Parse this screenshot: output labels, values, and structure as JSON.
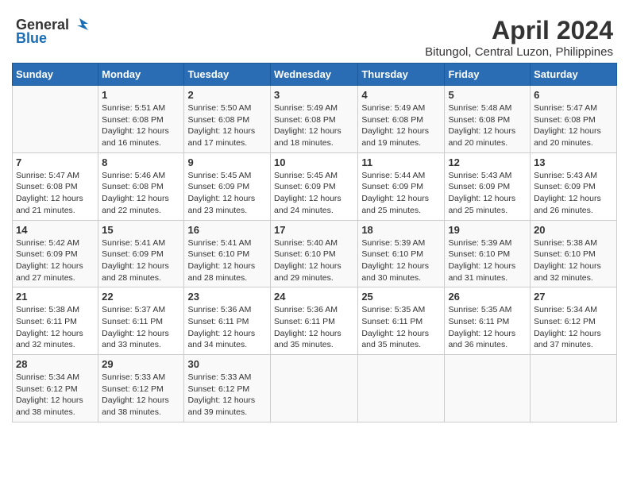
{
  "header": {
    "logo_general": "General",
    "logo_blue": "Blue",
    "title": "April 2024",
    "subtitle": "Bitungol, Central Luzon, Philippines"
  },
  "days_of_week": [
    "Sunday",
    "Monday",
    "Tuesday",
    "Wednesday",
    "Thursday",
    "Friday",
    "Saturday"
  ],
  "weeks": [
    {
      "days": [
        {
          "number": "",
          "info": ""
        },
        {
          "number": "1",
          "info": "Sunrise: 5:51 AM\nSunset: 6:08 PM\nDaylight: 12 hours\nand 16 minutes."
        },
        {
          "number": "2",
          "info": "Sunrise: 5:50 AM\nSunset: 6:08 PM\nDaylight: 12 hours\nand 17 minutes."
        },
        {
          "number": "3",
          "info": "Sunrise: 5:49 AM\nSunset: 6:08 PM\nDaylight: 12 hours\nand 18 minutes."
        },
        {
          "number": "4",
          "info": "Sunrise: 5:49 AM\nSunset: 6:08 PM\nDaylight: 12 hours\nand 19 minutes."
        },
        {
          "number": "5",
          "info": "Sunrise: 5:48 AM\nSunset: 6:08 PM\nDaylight: 12 hours\nand 20 minutes."
        },
        {
          "number": "6",
          "info": "Sunrise: 5:47 AM\nSunset: 6:08 PM\nDaylight: 12 hours\nand 20 minutes."
        }
      ]
    },
    {
      "days": [
        {
          "number": "7",
          "info": "Sunrise: 5:47 AM\nSunset: 6:08 PM\nDaylight: 12 hours\nand 21 minutes."
        },
        {
          "number": "8",
          "info": "Sunrise: 5:46 AM\nSunset: 6:08 PM\nDaylight: 12 hours\nand 22 minutes."
        },
        {
          "number": "9",
          "info": "Sunrise: 5:45 AM\nSunset: 6:09 PM\nDaylight: 12 hours\nand 23 minutes."
        },
        {
          "number": "10",
          "info": "Sunrise: 5:45 AM\nSunset: 6:09 PM\nDaylight: 12 hours\nand 24 minutes."
        },
        {
          "number": "11",
          "info": "Sunrise: 5:44 AM\nSunset: 6:09 PM\nDaylight: 12 hours\nand 25 minutes."
        },
        {
          "number": "12",
          "info": "Sunrise: 5:43 AM\nSunset: 6:09 PM\nDaylight: 12 hours\nand 25 minutes."
        },
        {
          "number": "13",
          "info": "Sunrise: 5:43 AM\nSunset: 6:09 PM\nDaylight: 12 hours\nand 26 minutes."
        }
      ]
    },
    {
      "days": [
        {
          "number": "14",
          "info": "Sunrise: 5:42 AM\nSunset: 6:09 PM\nDaylight: 12 hours\nand 27 minutes."
        },
        {
          "number": "15",
          "info": "Sunrise: 5:41 AM\nSunset: 6:09 PM\nDaylight: 12 hours\nand 28 minutes."
        },
        {
          "number": "16",
          "info": "Sunrise: 5:41 AM\nSunset: 6:10 PM\nDaylight: 12 hours\nand 28 minutes."
        },
        {
          "number": "17",
          "info": "Sunrise: 5:40 AM\nSunset: 6:10 PM\nDaylight: 12 hours\nand 29 minutes."
        },
        {
          "number": "18",
          "info": "Sunrise: 5:39 AM\nSunset: 6:10 PM\nDaylight: 12 hours\nand 30 minutes."
        },
        {
          "number": "19",
          "info": "Sunrise: 5:39 AM\nSunset: 6:10 PM\nDaylight: 12 hours\nand 31 minutes."
        },
        {
          "number": "20",
          "info": "Sunrise: 5:38 AM\nSunset: 6:10 PM\nDaylight: 12 hours\nand 32 minutes."
        }
      ]
    },
    {
      "days": [
        {
          "number": "21",
          "info": "Sunrise: 5:38 AM\nSunset: 6:11 PM\nDaylight: 12 hours\nand 32 minutes."
        },
        {
          "number": "22",
          "info": "Sunrise: 5:37 AM\nSunset: 6:11 PM\nDaylight: 12 hours\nand 33 minutes."
        },
        {
          "number": "23",
          "info": "Sunrise: 5:36 AM\nSunset: 6:11 PM\nDaylight: 12 hours\nand 34 minutes."
        },
        {
          "number": "24",
          "info": "Sunrise: 5:36 AM\nSunset: 6:11 PM\nDaylight: 12 hours\nand 35 minutes."
        },
        {
          "number": "25",
          "info": "Sunrise: 5:35 AM\nSunset: 6:11 PM\nDaylight: 12 hours\nand 35 minutes."
        },
        {
          "number": "26",
          "info": "Sunrise: 5:35 AM\nSunset: 6:11 PM\nDaylight: 12 hours\nand 36 minutes."
        },
        {
          "number": "27",
          "info": "Sunrise: 5:34 AM\nSunset: 6:12 PM\nDaylight: 12 hours\nand 37 minutes."
        }
      ]
    },
    {
      "days": [
        {
          "number": "28",
          "info": "Sunrise: 5:34 AM\nSunset: 6:12 PM\nDaylight: 12 hours\nand 38 minutes."
        },
        {
          "number": "29",
          "info": "Sunrise: 5:33 AM\nSunset: 6:12 PM\nDaylight: 12 hours\nand 38 minutes."
        },
        {
          "number": "30",
          "info": "Sunrise: 5:33 AM\nSunset: 6:12 PM\nDaylight: 12 hours\nand 39 minutes."
        },
        {
          "number": "",
          "info": ""
        },
        {
          "number": "",
          "info": ""
        },
        {
          "number": "",
          "info": ""
        },
        {
          "number": "",
          "info": ""
        }
      ]
    }
  ]
}
